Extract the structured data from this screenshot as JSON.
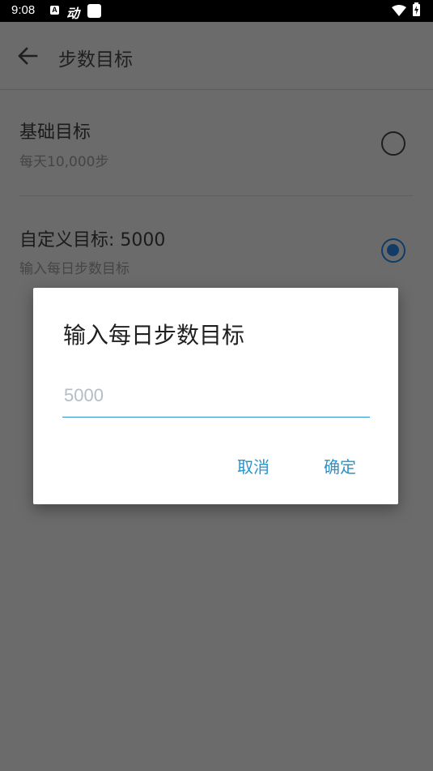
{
  "status_bar": {
    "time": "9:08",
    "notif_letter": "A",
    "app_glyph": "动",
    "icons": [
      "a-notification-icon",
      "app-icon",
      "square-icon",
      "wifi-icon",
      "battery-icon"
    ]
  },
  "header": {
    "title": "步数目标",
    "back_icon": "arrow-back-icon"
  },
  "options": [
    {
      "title": "基础目标",
      "subtitle": "每天10,000步",
      "selected": false
    },
    {
      "title": "自定义目标: 5000",
      "subtitle": "输入每日步数目标",
      "selected": true
    }
  ],
  "dialog": {
    "title": "输入每日步数目标",
    "input_value": "",
    "input_placeholder": "5000",
    "cancel_label": "取消",
    "ok_label": "确定"
  },
  "colors": {
    "accent": "#2a93c9",
    "radio_selected": "#113c68",
    "scrim_background": "#6b6b6b"
  }
}
